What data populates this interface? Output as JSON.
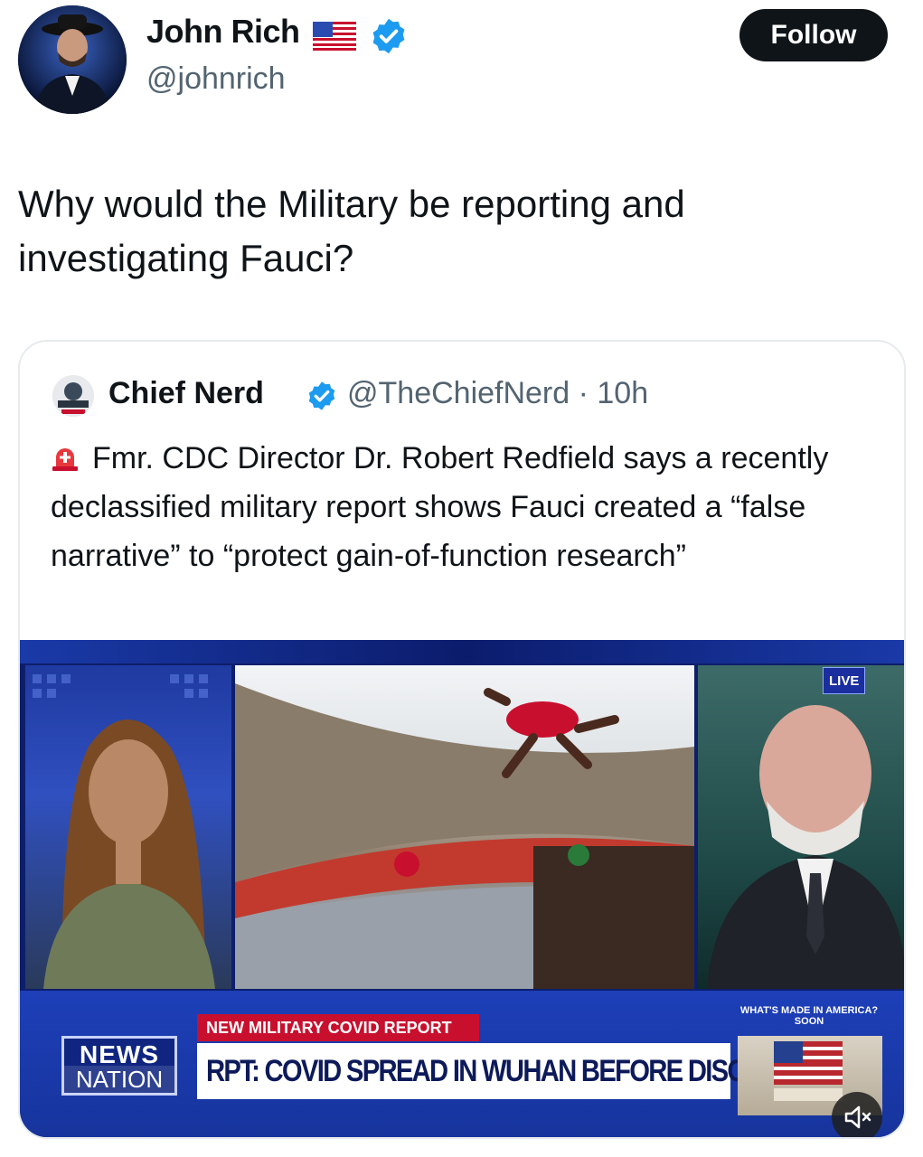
{
  "post": {
    "author_name": "John Rich",
    "author_handle": "@johnrich",
    "follow_label": "Follow",
    "text": "Why would the Military be reporting and investigating Fauci?"
  },
  "quote": {
    "author_name": "Chief Nerd",
    "handle_time": "@TheChiefNerd · 10h",
    "text": "Fmr. CDC Director Dr. Robert Redfield says a recently declassified military report shows Fauci created a “false narrative” to “protect gain-of-function research”"
  },
  "video": {
    "live_badge": "LIVE",
    "network_top": "NEWS",
    "network_bottom": "NATION",
    "banner_tag": "NEW MILITARY COVID REPORT",
    "headline": "RPT: COVID SPREAD IN WUHAN BEFORE DISCLOSED",
    "promo_line1": "WHAT'S MADE IN AMERICA?",
    "promo_line2": "SOON"
  },
  "colors": {
    "verified": "#1d9bf0",
    "network_blue": "#1d3fb8",
    "banner_red": "#c8102e"
  },
  "icons": [
    "verified-badge-icon",
    "us-flag-icon",
    "siren-icon",
    "mute-icon"
  ]
}
